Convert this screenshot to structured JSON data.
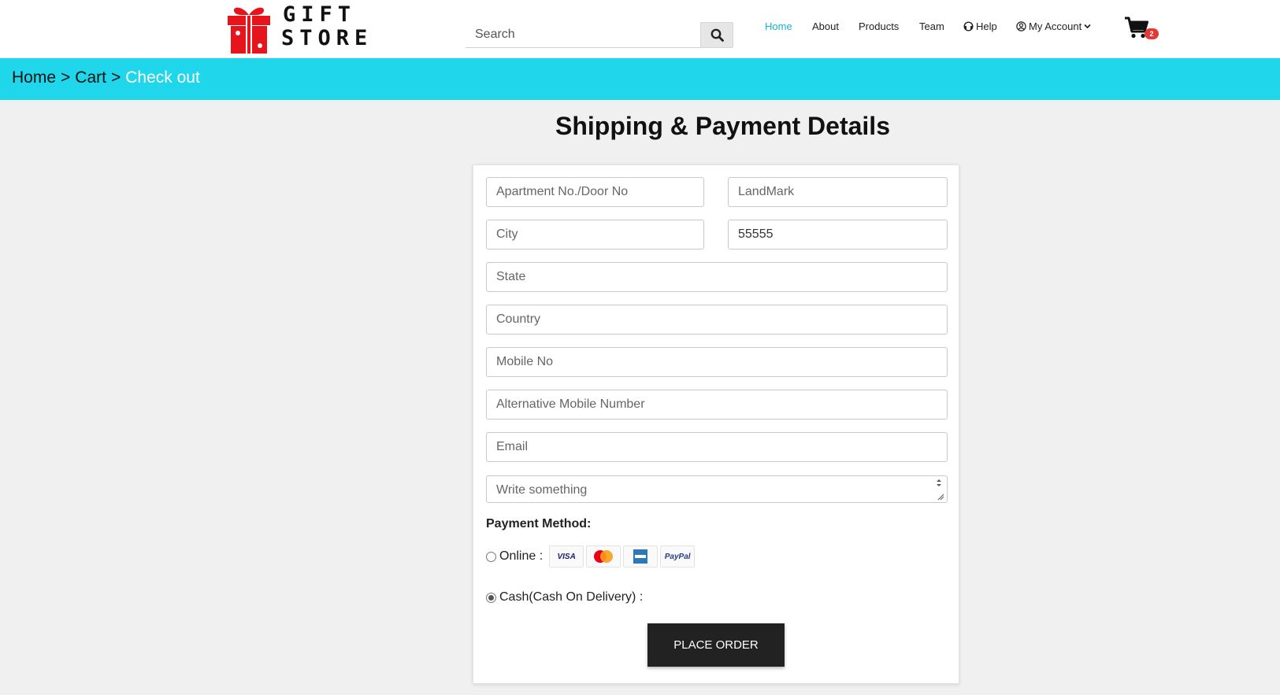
{
  "brand": {
    "line1": "GIFT",
    "line2": "STORE",
    "accent": "#e8141c"
  },
  "search": {
    "placeholder": "Search"
  },
  "nav": {
    "items": [
      {
        "label": "Home",
        "active": true
      },
      {
        "label": "About"
      },
      {
        "label": "Products"
      },
      {
        "label": "Team"
      },
      {
        "label": "Help",
        "icon": "headset-icon"
      },
      {
        "label": "My Account",
        "icon": "user-circle-icon",
        "dropdown": true
      }
    ],
    "cart_count": "2"
  },
  "breadcrumb": {
    "home": "Home",
    "sep1": ">",
    "cart": "Cart",
    "sep2": ">",
    "current": "Check out"
  },
  "page_title": "Shipping & Payment Details",
  "form": {
    "apartment": {
      "placeholder": "Apartment No./Door No",
      "value": ""
    },
    "landmark": {
      "placeholder": "LandMark",
      "value": ""
    },
    "city": {
      "placeholder": "City",
      "value": ""
    },
    "pincode": {
      "placeholder": "",
      "value": "55555"
    },
    "state": {
      "placeholder": "State",
      "value": ""
    },
    "country": {
      "placeholder": "Country",
      "value": ""
    },
    "mobile": {
      "placeholder": "Mobile No",
      "value": ""
    },
    "alt_mobile": {
      "placeholder": "Alternative Mobile Number",
      "value": ""
    },
    "email": {
      "placeholder": "Email",
      "value": ""
    },
    "notes": {
      "placeholder": "Write something",
      "value": ""
    },
    "payment_label": "Payment Method:",
    "online_label": "Online :",
    "online_checked": false,
    "cash_label": "Cash(Cash On Delivery) :",
    "cash_checked": true,
    "card_icons": [
      "visa-icon",
      "mastercard-icon",
      "amex-icon",
      "paypal-icon"
    ],
    "visa_text": "VISA",
    "paypal_text": "PayPal",
    "submit_label": "PLACE ORDER"
  },
  "colors": {
    "accent": "#1fd6ea",
    "active_nav": "#16b3cf",
    "badge": "#e53935",
    "button": "#222222"
  }
}
